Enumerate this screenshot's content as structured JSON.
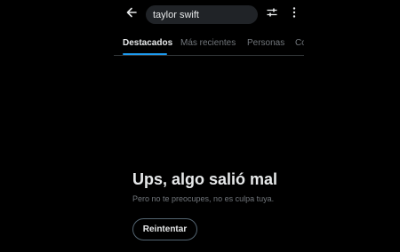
{
  "header": {
    "back_icon": "arrow-left-icon",
    "search": {
      "value": "taylor swift",
      "placeholder": ""
    },
    "filter_icon": "sliders-icon",
    "more_icon": "vertical-ellipsis-icon"
  },
  "tabs": [
    {
      "label": "Destacados",
      "active": true
    },
    {
      "label": "Más recientes",
      "active": false
    },
    {
      "label": "Personas",
      "active": false
    },
    {
      "label": "Co",
      "active": false
    }
  ],
  "error": {
    "title": "Ups, algo salió mal",
    "subtitle": "Pero no te preocupes, no es culpa tuya.",
    "retry_label": "Reintentar"
  },
  "colors": {
    "background": "#000000",
    "accent": "#1d9bf0",
    "text_primary": "#e7e9ea",
    "text_secondary": "#71767b"
  }
}
